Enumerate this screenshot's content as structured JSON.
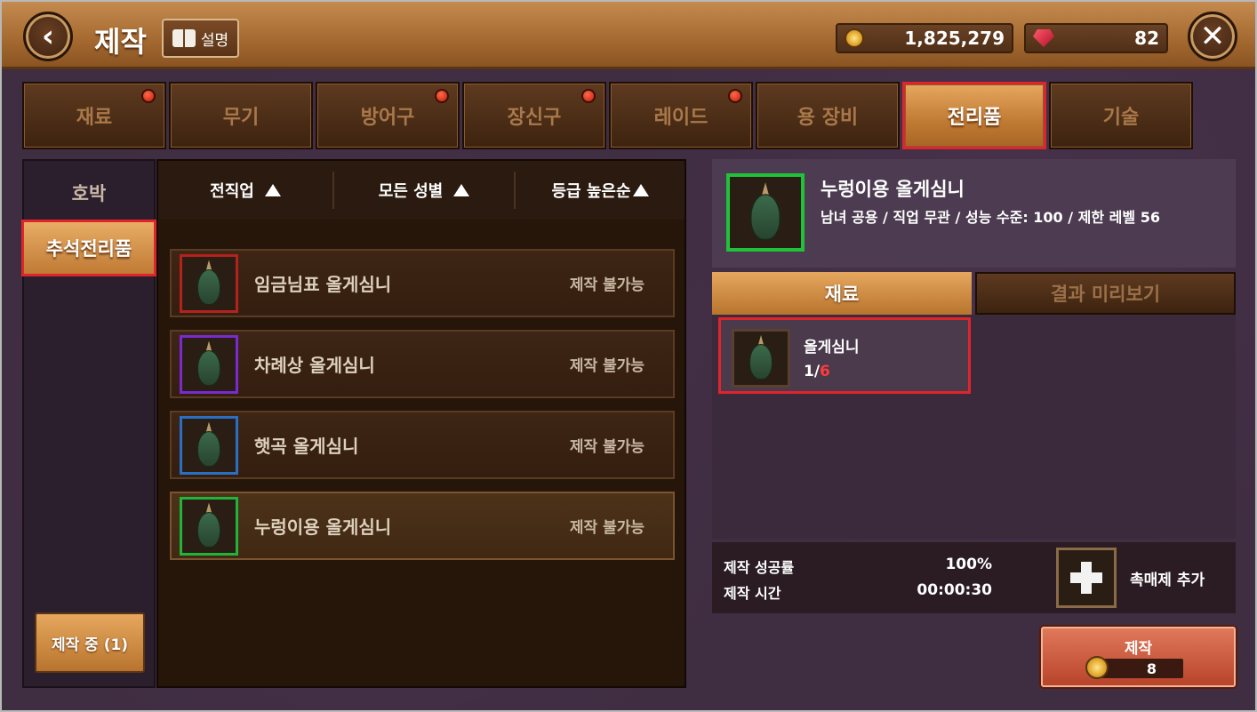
{
  "header": {
    "title": "제작",
    "help_label": "설명",
    "gold": "1,825,279",
    "gems": "82"
  },
  "tabs": [
    {
      "label": "재료",
      "dot": true
    },
    {
      "label": "무기",
      "dot": false
    },
    {
      "label": "방어구",
      "dot": true
    },
    {
      "label": "장신구",
      "dot": true
    },
    {
      "label": "레이드",
      "dot": true
    },
    {
      "label": "용 장비",
      "dot": false
    },
    {
      "label": "전리품",
      "dot": false,
      "active": true
    },
    {
      "label": "기술",
      "dot": false
    }
  ],
  "categories": [
    {
      "label": "호박",
      "active": false
    },
    {
      "label": "추석전리품",
      "active": true
    }
  ],
  "crafting_queue_label": "제작 중 (1)",
  "sort": {
    "class": "전직업",
    "gender": "모든 성별",
    "grade": "등급 높은순"
  },
  "items": [
    {
      "name": "임금님표 올게심니",
      "status": "제작 불가능",
      "frame_color": "#b4221e"
    },
    {
      "name": "차례상 올게심니",
      "status": "제작 불가능",
      "frame_color": "#7a2ad0"
    },
    {
      "name": "햇곡 올게심니",
      "status": "제작 불가능",
      "frame_color": "#2a6fc4"
    },
    {
      "name": "누렁이용 올게심니",
      "status": "제작 불가능",
      "frame_color": "#20b43a"
    }
  ],
  "detail": {
    "name": "누렁이용 올게심니",
    "info": "남녀 공용 / 직업 무관 / 성능 수준: 100 / 제한 레벨 56"
  },
  "sub_tabs": {
    "materials": "재료",
    "preview": "결과 미리보기"
  },
  "material": {
    "name": "올게심니",
    "have": "1/",
    "need": "6"
  },
  "stats": {
    "success_label": "제작 성공률",
    "success_value": "100%",
    "time_label": "제작 시간",
    "time_value": "00:00:30",
    "catalyst_label": "촉매제 추가"
  },
  "craft": {
    "label": "제작",
    "cost": "8"
  }
}
